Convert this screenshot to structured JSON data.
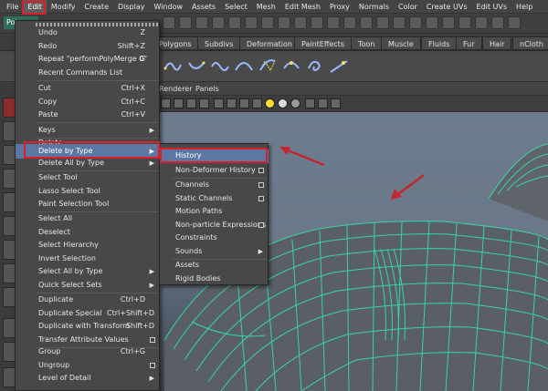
{
  "menubar": {
    "items": [
      "File",
      "Edit",
      "Modify",
      "Create",
      "Display",
      "Window",
      "Assets",
      "Select",
      "Mesh",
      "Edit Mesh",
      "Proxy",
      "Normals",
      "Color",
      "Create UVs",
      "Edit UVs",
      "Help"
    ]
  },
  "status": {
    "mode": "Pol"
  },
  "shelf": {
    "tabs": [
      "Polygons",
      "Subdivs",
      "Deformation",
      "PaintEffects",
      "Toon",
      "Muscle",
      "Fluids",
      "Fur",
      "Hair",
      "nCloth"
    ]
  },
  "panel": {
    "menus": [
      "Renderer",
      "Panels"
    ]
  },
  "edit_menu": {
    "items": [
      {
        "label": "Undo",
        "shortcut": "Z"
      },
      {
        "label": "Redo",
        "shortcut": "Shift+Z"
      },
      {
        "label": "Repeat \"performPolyMerge 0\"",
        "shortcut": "G"
      },
      {
        "label": "Recent Commands List",
        "shortcut": ""
      },
      {
        "label": "Cut",
        "shortcut": "Ctrl+X"
      },
      {
        "label": "Copy",
        "shortcut": "Ctrl+C"
      },
      {
        "label": "Paste",
        "shortcut": "Ctrl+V"
      },
      {
        "label": "Keys",
        "shortcut": ""
      },
      {
        "label": "Delete",
        "shortcut": ""
      },
      {
        "label": "Delete by Type",
        "shortcut": ""
      },
      {
        "label": "Delete All by Type",
        "shortcut": ""
      },
      {
        "label": "Select Tool",
        "shortcut": ""
      },
      {
        "label": "Lasso Select Tool",
        "shortcut": ""
      },
      {
        "label": "Paint Selection Tool",
        "shortcut": ""
      },
      {
        "label": "Select All",
        "shortcut": ""
      },
      {
        "label": "Deselect",
        "shortcut": ""
      },
      {
        "label": "Select Hierarchy",
        "shortcut": ""
      },
      {
        "label": "Invert Selection",
        "shortcut": ""
      },
      {
        "label": "Select All by Type",
        "shortcut": ""
      },
      {
        "label": "Quick Select Sets",
        "shortcut": ""
      },
      {
        "label": "Duplicate",
        "shortcut": "Ctrl+D"
      },
      {
        "label": "Duplicate Special",
        "shortcut": "Ctrl+Shift+D"
      },
      {
        "label": "Duplicate with Transform",
        "shortcut": "Shift+D"
      },
      {
        "label": "Transfer Attribute Values",
        "shortcut": ""
      },
      {
        "label": "Group",
        "shortcut": "Ctrl+G"
      },
      {
        "label": "Ungroup",
        "shortcut": ""
      },
      {
        "label": "Level of Detail",
        "shortcut": ""
      }
    ]
  },
  "delete_by_type_menu": {
    "items": [
      {
        "label": "History"
      },
      {
        "label": "Non-Deformer History"
      },
      {
        "label": "Channels"
      },
      {
        "label": "Static Channels"
      },
      {
        "label": "Motion Paths"
      },
      {
        "label": "Non-particle Expressions"
      },
      {
        "label": "Constraints"
      },
      {
        "label": "Sounds"
      },
      {
        "label": "Assets"
      },
      {
        "label": "Rigid Bodies"
      }
    ]
  },
  "colors": {
    "highlight": "#5d77a5",
    "annotation": "#d8202a",
    "mesh_wire": "#33e0b0"
  }
}
